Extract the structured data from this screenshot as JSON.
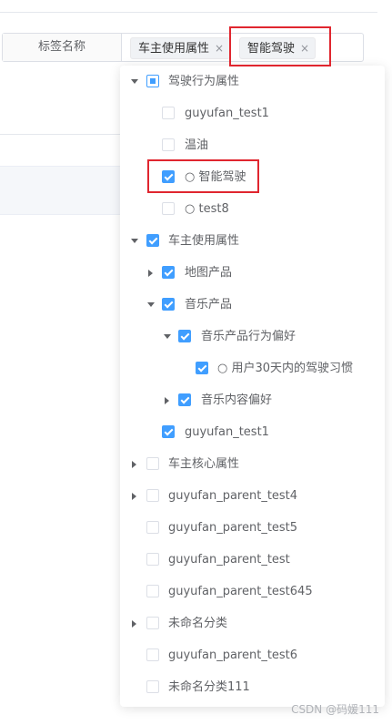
{
  "form": {
    "label": "标签名称",
    "tags": [
      {
        "text": "车主使用属性",
        "close": "×"
      },
      {
        "text": "智能驾驶",
        "close": "×"
      }
    ]
  },
  "tree": [
    {
      "label": "驾驶行为属性",
      "state": "indeterminate",
      "caret": "down"
    },
    {
      "label": "guyufan_test1",
      "state": "unchecked",
      "caret": ""
    },
    {
      "label": "温油",
      "state": "unchecked",
      "caret": ""
    },
    {
      "label": "○ 智能驾驶",
      "state": "checked",
      "caret": ""
    },
    {
      "label": "○ test8",
      "state": "unchecked",
      "caret": ""
    },
    {
      "label": "车主使用属性",
      "state": "checked",
      "caret": "down"
    },
    {
      "label": "地图产品",
      "state": "checked",
      "caret": "right"
    },
    {
      "label": "音乐产品",
      "state": "checked",
      "caret": "down"
    },
    {
      "label": "音乐产品行为偏好",
      "state": "checked",
      "caret": "down"
    },
    {
      "label": "○ 用户30天内的驾驶习惯",
      "state": "checked",
      "caret": ""
    },
    {
      "label": "音乐内容偏好",
      "state": "checked",
      "caret": "right"
    },
    {
      "label": "guyufan_test1",
      "state": "checked",
      "caret": ""
    },
    {
      "label": "车主核心属性",
      "state": "unchecked",
      "caret": "right"
    },
    {
      "label": "guyufan_parent_test4",
      "state": "unchecked",
      "caret": "right"
    },
    {
      "label": "guyufan_parent_test5",
      "state": "unchecked",
      "caret": ""
    },
    {
      "label": "guyufan_parent_test",
      "state": "unchecked",
      "caret": ""
    },
    {
      "label": "guyufan_parent_test645",
      "state": "unchecked",
      "caret": ""
    },
    {
      "label": "未命名分类",
      "state": "unchecked",
      "caret": "right"
    },
    {
      "label": "guyufan_parent_test6",
      "state": "unchecked",
      "caret": ""
    },
    {
      "label": "未命名分类111",
      "state": "unchecked",
      "caret": ""
    }
  ],
  "watermark": "CSDN @码媛111",
  "colors": {
    "accent": "#409eff",
    "highlight": "#e0262f"
  }
}
